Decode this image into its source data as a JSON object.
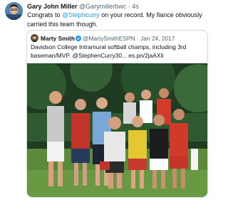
{
  "tweet": {
    "author_name": "Gary John Miller",
    "author_handle": "@Garymillerbwc",
    "separator": "·",
    "time": "4s",
    "text_prefix": "Congrats to ",
    "mention": "@Stephcurry",
    "text_suffix": " on your record. My fiance obviously carried this team though."
  },
  "quote": {
    "author_name": "Marty Smith",
    "author_handle": "@MartySmithESPN",
    "separator": "·",
    "date": "Jan 24, 2017",
    "text": "Davidson College Intramural softball champs, including 3rd baseman/MVP. @StephenCurry30... es.pn/2jaAXIi"
  },
  "colors": {
    "link": "#1d9bf0",
    "muted": "#536471",
    "border": "#cfd9de",
    "verified": "#1d9bf0"
  },
  "icons": {
    "verified": "verified-badge-icon"
  }
}
